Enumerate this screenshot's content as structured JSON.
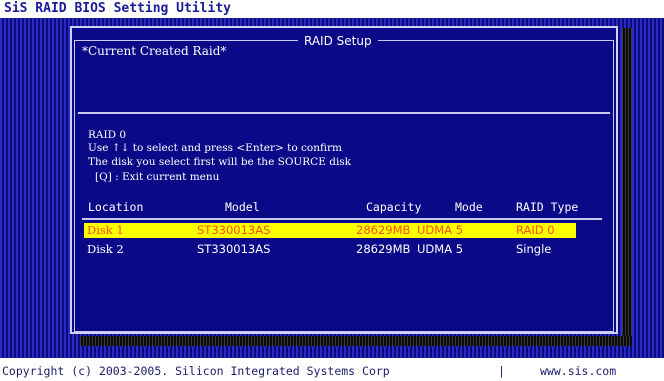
{
  "app": {
    "title": "SiS RAID BIOS Setting Utility"
  },
  "dialog": {
    "title": "RAID Setup",
    "current_label": "*Current Created Raid*"
  },
  "info": {
    "mode_line": "RAID 0",
    "instruction": "Use ↑↓ to select and press <Enter> to confirm",
    "source_note": "The disk you select first will be the SOURCE disk",
    "exit_hint": "[Q] : Exit current menu"
  },
  "table": {
    "headers": [
      "Location",
      "Model",
      "Capacity",
      "Mode",
      "RAID Type"
    ],
    "rows": [
      {
        "location": "Disk 1",
        "model": "ST330013AS",
        "capacity": "28629MB",
        "mode": "UDMA 5",
        "raid_type": "RAID 0",
        "selected": true
      },
      {
        "location": "Disk 2",
        "model": "ST330013AS",
        "capacity": "28629MB",
        "mode": "UDMA 5",
        "raid_type": "Single",
        "selected": false
      }
    ]
  },
  "footer": {
    "copyright": "Copyright (c) 2003-2005. Silicon Integrated Systems Corp",
    "separator": "|",
    "website": "www.sis.com"
  },
  "colors": {
    "screen_blue": "#1414a0",
    "dialog_blue": "#0a0a88",
    "highlight_bg": "#ffff00",
    "highlight_fg": "#ff5000"
  }
}
